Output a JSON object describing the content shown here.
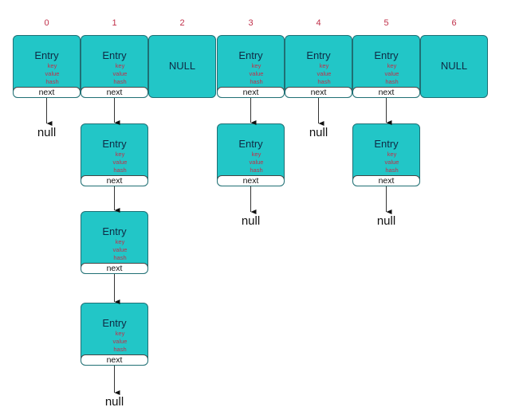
{
  "diagram": {
    "type": "hashmap-bucket-chaining",
    "colors": {
      "entry_fill": "#22c6c7",
      "entry_border": "#1f6f74",
      "index_label": "#c0304a",
      "field_text": "#c0304a",
      "title_text": "#0f2a44"
    },
    "entry_labels": {
      "title": "Entry",
      "fields": [
        "key",
        "value",
        "hash"
      ],
      "next": "next"
    },
    "null_slot_label": "NULL",
    "terminator_label": "null",
    "buckets": [
      {
        "index": "0",
        "chain_length": 1
      },
      {
        "index": "1",
        "chain_length": 4
      },
      {
        "index": "2",
        "chain_length": 0
      },
      {
        "index": "3",
        "chain_length": 2
      },
      {
        "index": "4",
        "chain_length": 1
      },
      {
        "index": "5",
        "chain_length": 2
      },
      {
        "index": "6",
        "chain_length": 0
      }
    ]
  }
}
